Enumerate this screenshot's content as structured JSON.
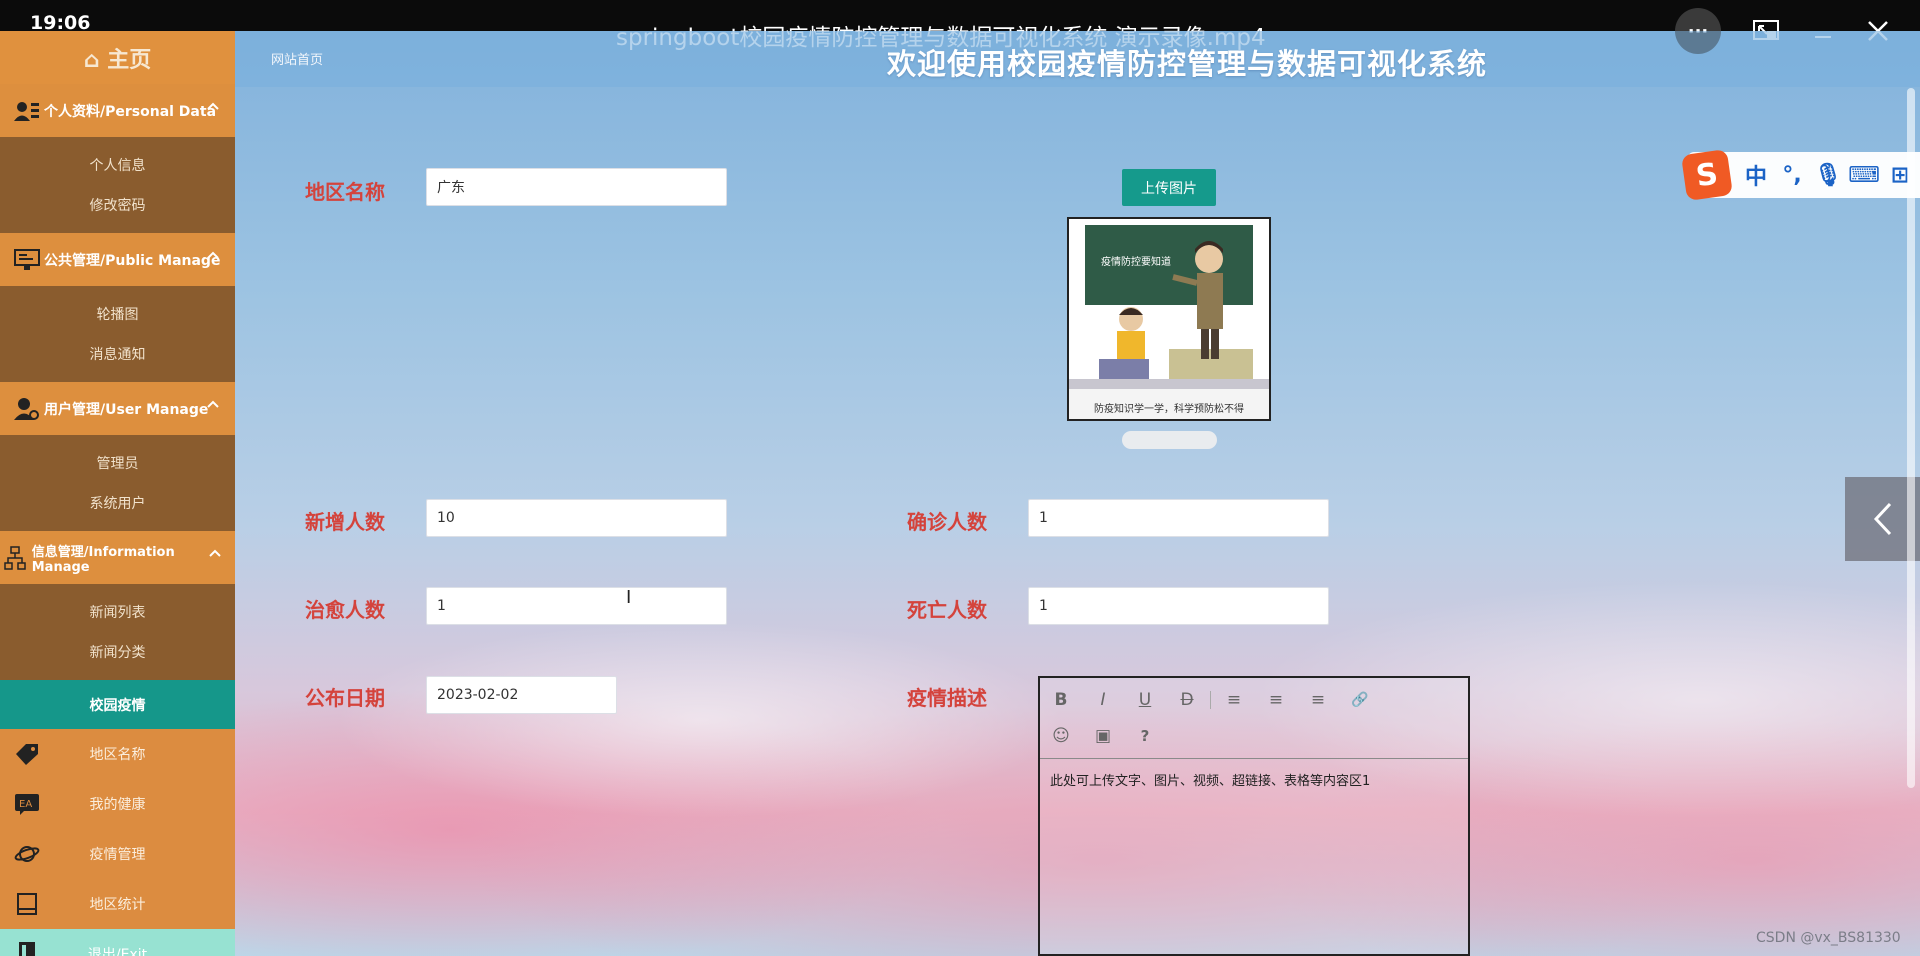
{
  "player": {
    "time": "19:06",
    "title": "springboot校园疫情防控管理与数据可视化系统 演示录像.mp4",
    "more_label": "···"
  },
  "sidebar": {
    "home": "⌂ 主页",
    "groups": [
      {
        "label": "个人资料/Personal Data",
        "items": [
          "个人信息",
          "修改密码"
        ]
      },
      {
        "label": "公共管理/Public Manage",
        "items": [
          "轮播图",
          "消息通知"
        ]
      },
      {
        "label": "用户管理/User Manage",
        "items": [
          "管理员",
          "系统用户"
        ]
      },
      {
        "label": "信息管理/Information Manage",
        "items": [
          "新闻列表",
          "新闻分类"
        ]
      }
    ],
    "active_item": "校园疫情",
    "items": [
      "地区名称",
      "我的健康",
      "疫情管理",
      "地区统计"
    ],
    "exit": "退出/Exit"
  },
  "header": {
    "breadcrumb": "网站首页",
    "title": "欢迎使用校园疫情防控管理与数据可视化系统"
  },
  "form": {
    "region_label": "地区名称",
    "region_value": "广东",
    "upload_label": "上传图片",
    "preview_caption": "防疫知识学一学，科学预防松不得",
    "preview_board_text": "疫情防控要知道",
    "new_label": "新增人数",
    "new_value": "10",
    "confirmed_label": "确诊人数",
    "confirmed_value": "1",
    "cured_label": "治愈人数",
    "cured_value": "1",
    "death_label": "死亡人数",
    "death_value": "1",
    "date_label": "公布日期",
    "date_value": "2023-02-02",
    "desc_label": "疫情描述",
    "desc_value": "此处可上传文字、图片、视频、超链接、表格等内容区1"
  },
  "editor": {
    "toolbar": [
      "B",
      "I",
      "U",
      "D",
      "≡",
      "≡",
      "≡",
      "🔗",
      "☺",
      "▣",
      "?"
    ]
  },
  "ime": {
    "items": [
      "中",
      "°,",
      "🎙",
      "⌨",
      "⊞"
    ],
    "logo": "S"
  },
  "watermark": "CSDN @vx_BS81330"
}
